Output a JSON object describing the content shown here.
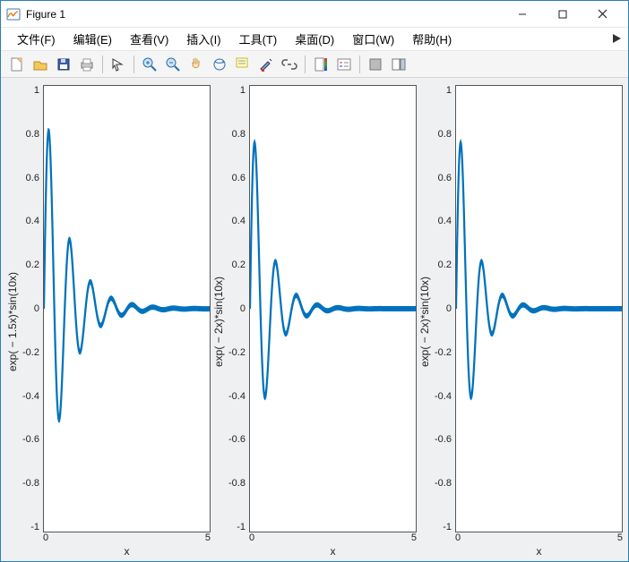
{
  "window": {
    "title": "Figure 1",
    "icon": "matlab-figure-icon"
  },
  "menu": {
    "items": [
      {
        "label": "文件(F)"
      },
      {
        "label": "编辑(E)"
      },
      {
        "label": "查看(V)"
      },
      {
        "label": "插入(I)"
      },
      {
        "label": "工具(T)"
      },
      {
        "label": "桌面(D)"
      },
      {
        "label": "窗口(W)"
      },
      {
        "label": "帮助(H)"
      }
    ]
  },
  "toolbar": {
    "groups": [
      [
        "new-figure",
        "open",
        "save",
        "print"
      ],
      [
        "arrow"
      ],
      [
        "zoom-in",
        "zoom-out",
        "pan",
        "rotate3d",
        "data-cursor",
        "brush",
        "link"
      ],
      [
        "insert-colorbar",
        "insert-legend"
      ],
      [
        "hide-plottools",
        "show-plottools"
      ]
    ]
  },
  "axes_common": {
    "ylim": [
      -1,
      1
    ],
    "yticks": [
      -1,
      -0.8,
      -0.6,
      -0.4,
      -0.2,
      0,
      0.2,
      0.4,
      0.6,
      0.8,
      1
    ],
    "ytick_labels": [
      "-1",
      "-0.8",
      "-0.6",
      "-0.4",
      "-0.2",
      "0",
      "0.2",
      "0.4",
      "0.6",
      "0.8",
      "1"
    ],
    "xlim": [
      0,
      5
    ],
    "xticks": [
      0,
      5
    ],
    "xtick_labels": [
      "0",
      "5"
    ],
    "xlabel": "x",
    "line_color": "#0072BD"
  },
  "chart_data": [
    {
      "type": "line",
      "decay": 1.5,
      "ylabel": "exp( − 1.5x)*sin(10x)",
      "xlabel": "x",
      "xlim": [
        0,
        5
      ],
      "ylim": [
        -1,
        1
      ]
    },
    {
      "type": "line",
      "decay": 2.0,
      "ylabel": "exp( − 2x)*sin(10x)",
      "xlabel": "x",
      "xlim": [
        0,
        5
      ],
      "ylim": [
        -1,
        1
      ]
    },
    {
      "type": "line",
      "decay": 2.0,
      "ylabel": "exp( − 2x)*sin(10x)",
      "xlabel": "x",
      "xlim": [
        0,
        5
      ],
      "ylim": [
        -1,
        1
      ]
    }
  ]
}
